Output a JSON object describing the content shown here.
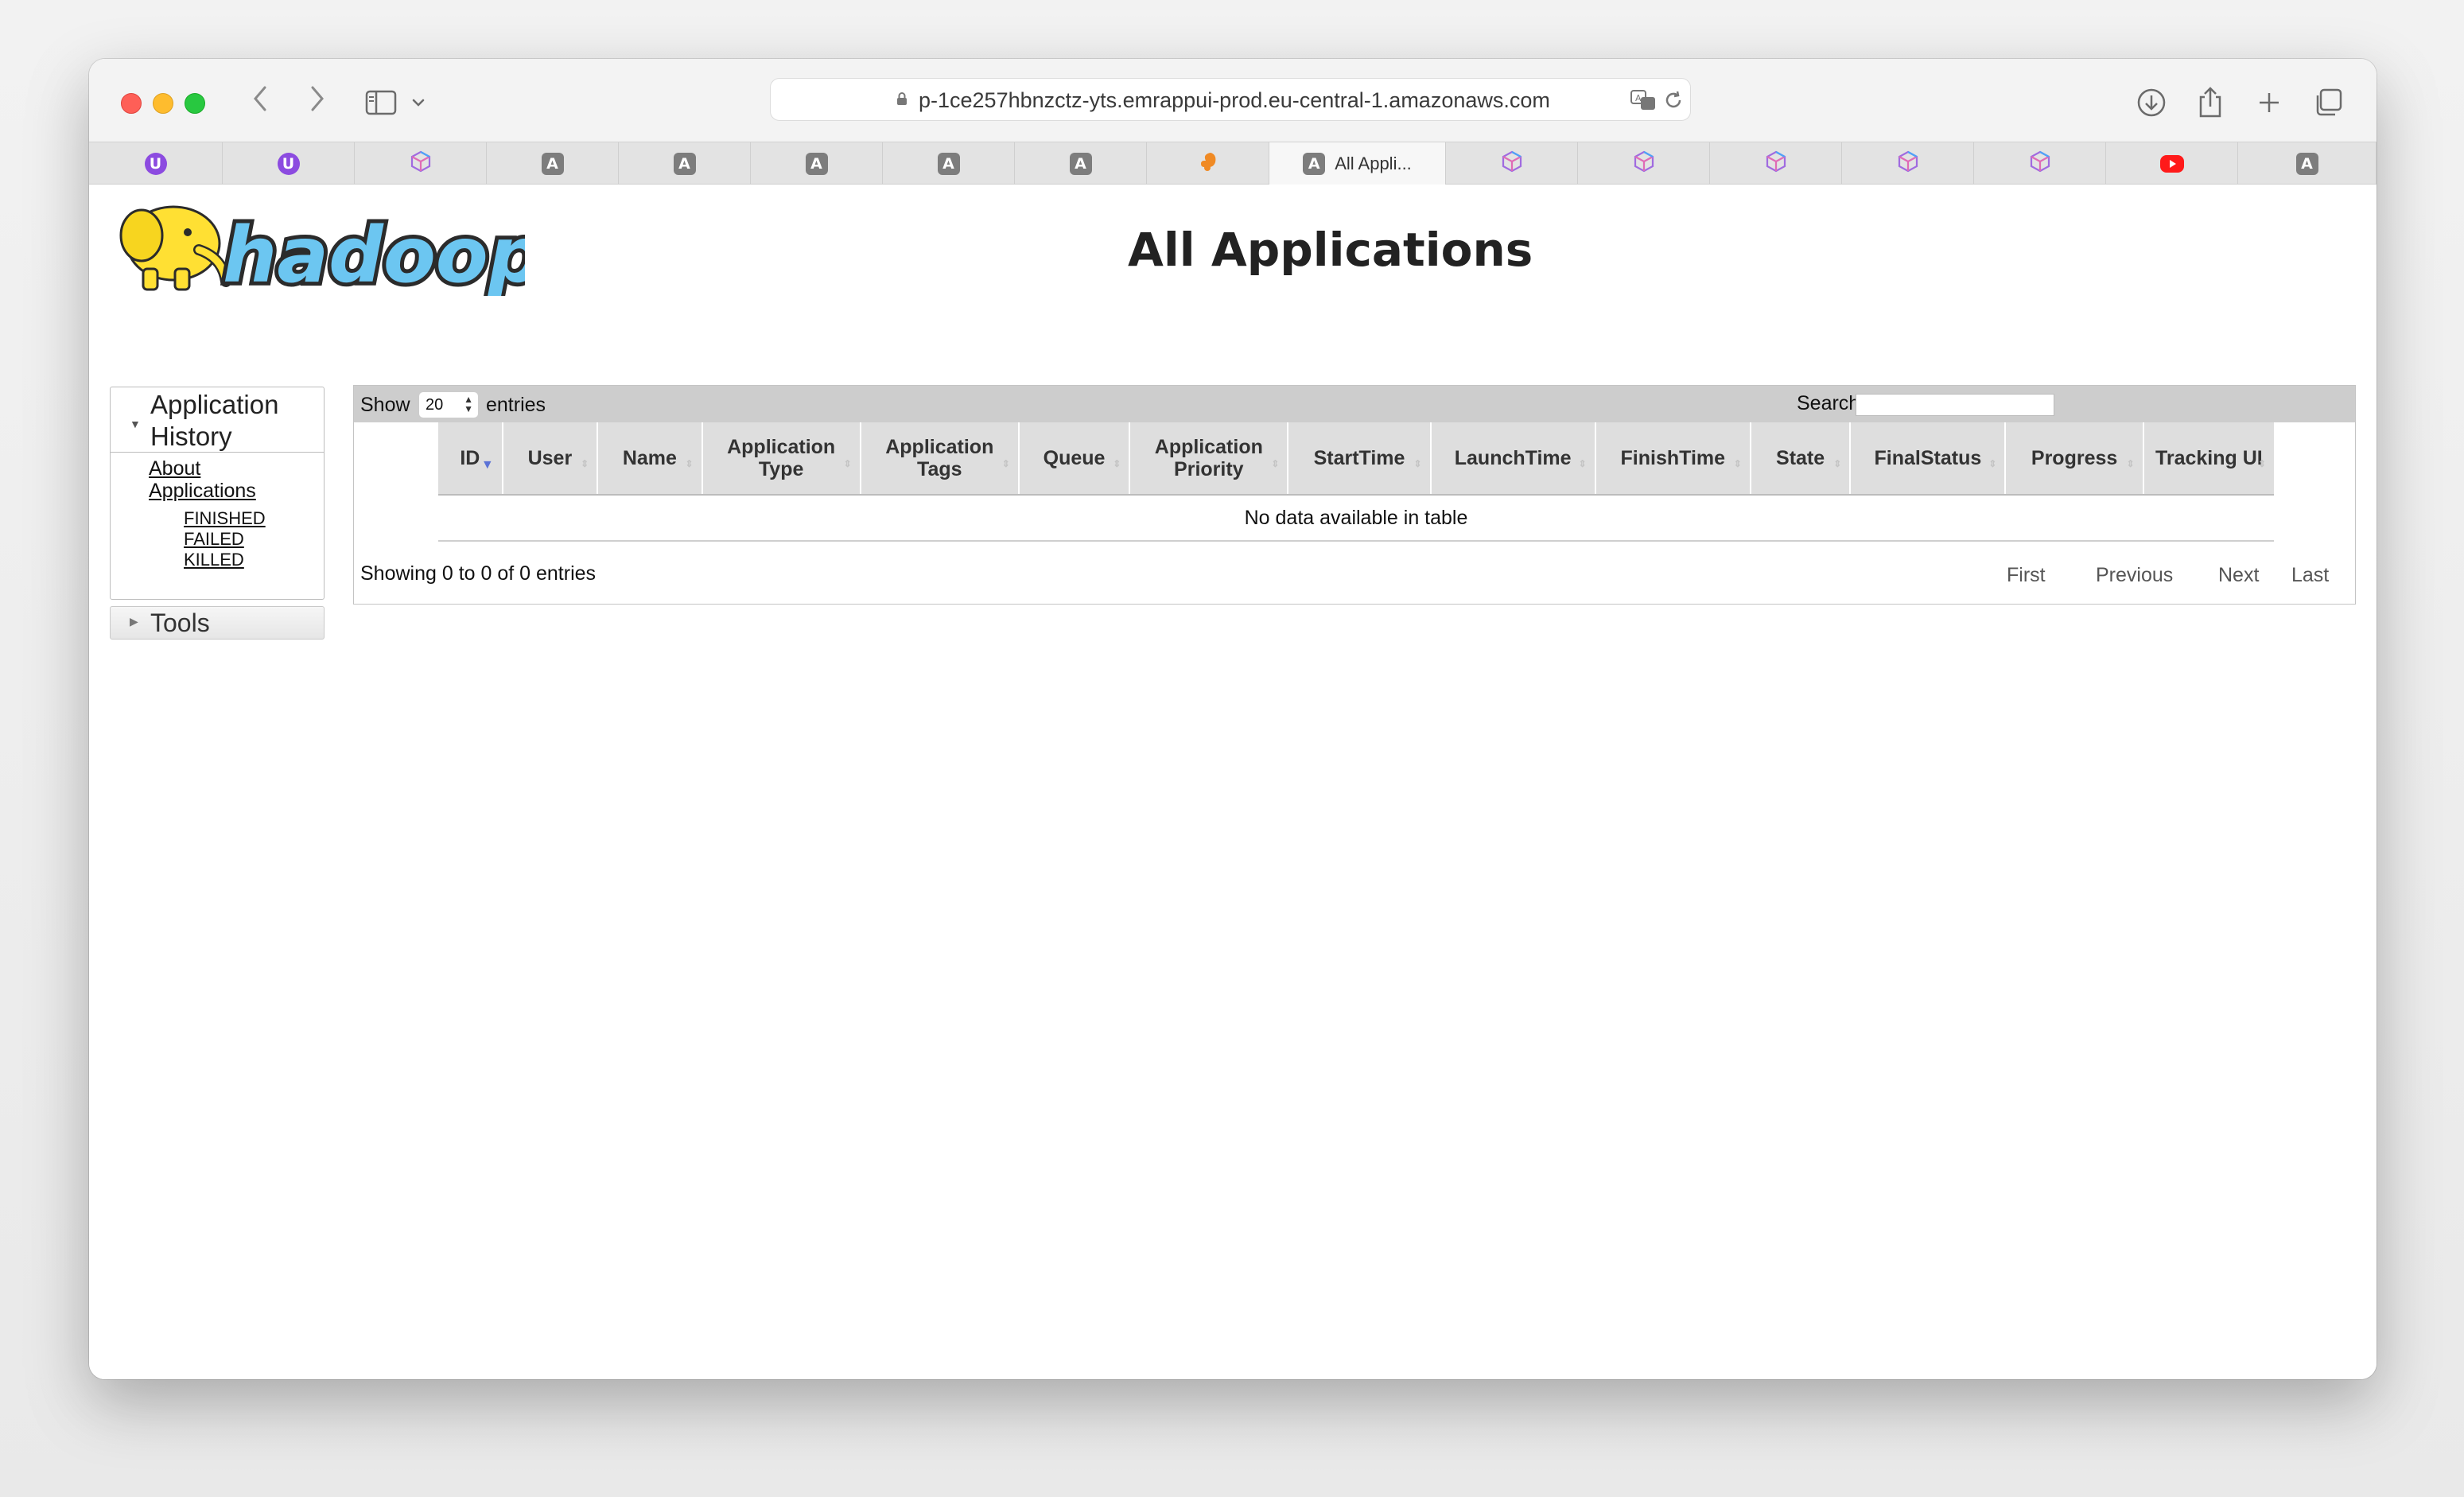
{
  "browser": {
    "url": "p-1ce257hbnzctz-yts.emrappui-prod.eu-central-1.amazonaws.com",
    "active_tab_title": "All Appli...",
    "tabs": [
      {
        "icon": "u-icon",
        "glyph": "U"
      },
      {
        "icon": "u-icon",
        "glyph": "U"
      },
      {
        "icon": "cube-icon",
        "glyph": ""
      },
      {
        "icon": "a-icon",
        "glyph": "A"
      },
      {
        "icon": "a-icon",
        "glyph": "A"
      },
      {
        "icon": "a-icon",
        "glyph": "A"
      },
      {
        "icon": "a-icon",
        "glyph": "A"
      },
      {
        "icon": "a-icon",
        "glyph": "A"
      },
      {
        "icon": "squirrel-icon",
        "glyph": ""
      },
      {
        "icon": "a-icon",
        "glyph": "A",
        "title": "All Appli...",
        "active": true
      },
      {
        "icon": "cube-icon",
        "glyph": ""
      },
      {
        "icon": "cube-icon",
        "glyph": ""
      },
      {
        "icon": "cube-icon",
        "glyph": ""
      },
      {
        "icon": "cube-icon",
        "glyph": ""
      },
      {
        "icon": "cube-icon",
        "glyph": ""
      },
      {
        "icon": "youtube-icon",
        "glyph": ""
      },
      {
        "icon": "a-icon",
        "glyph": "A"
      }
    ]
  },
  "page": {
    "title": "All Applications",
    "logo_text": "hadoop"
  },
  "sidebar": {
    "section_title": "Application History",
    "about_label": "About",
    "applications_label": "Applications",
    "sub_items": [
      "FINISHED",
      "FAILED",
      "KILLED"
    ],
    "tools_label": "Tools"
  },
  "table": {
    "show_label": "Show",
    "page_size": "20",
    "entries_label": "entries",
    "search_label": "Search:",
    "columns": [
      "ID",
      "User",
      "Name",
      "Application Type",
      "Application Tags",
      "Queue",
      "Application Priority",
      "StartTime",
      "LaunchTime",
      "FinishTime",
      "State",
      "FinalStatus",
      "Progress",
      "Tracking UI"
    ],
    "empty_message": "No data available in table",
    "info": "Showing 0 to 0 of 0 entries",
    "pager": {
      "first": "First",
      "previous": "Previous",
      "next": "Next",
      "last": "Last"
    }
  }
}
